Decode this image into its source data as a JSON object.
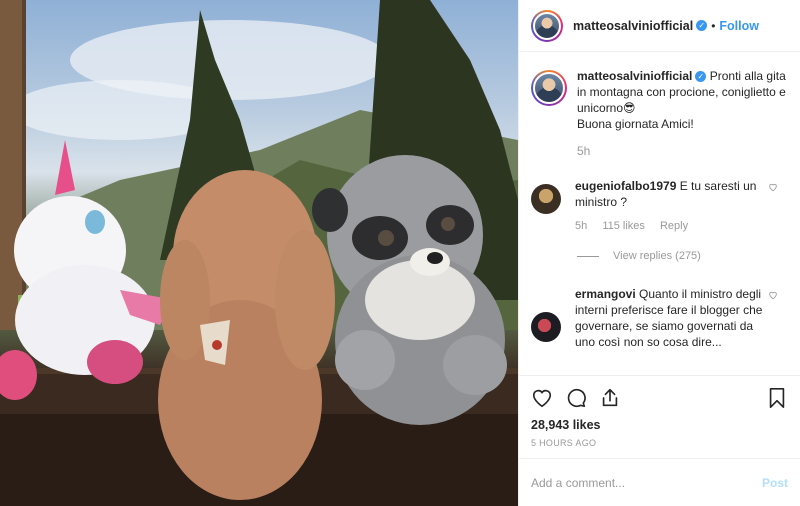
{
  "header": {
    "username": "matteosalviniofficial",
    "separator": "•",
    "follow_label": "Follow"
  },
  "caption": {
    "username": "matteosalviniofficial",
    "text_line1": "Pronti alla gita in montagna con procione, coniglietto e unicorno😎",
    "text_line2": "Buona giornata Amici!",
    "time": "5h"
  },
  "comments": [
    {
      "username": "eugeniofalbo1979",
      "text": "E tu saresti un ministro ?",
      "time": "5h",
      "likes": "115 likes",
      "reply": "Reply",
      "view_replies": "View replies (275)"
    },
    {
      "username": "ermangovi",
      "text": "Quanto il ministro degli interni preferisce fare il blogger che governare, se siamo governati da uno così non so cosa dire..."
    }
  ],
  "actions": {
    "likes": "28,943 likes",
    "timestamp": "5 HOURS AGO"
  },
  "add_comment": {
    "placeholder": "Add a comment...",
    "post_label": "Post"
  },
  "colors": {
    "accent": "#3897f0",
    "muted": "#999999",
    "post_disabled": "#b2dffc"
  },
  "icons": [
    "verified-badge-icon",
    "heart-icon",
    "comment-icon",
    "share-icon",
    "bookmark-icon"
  ]
}
